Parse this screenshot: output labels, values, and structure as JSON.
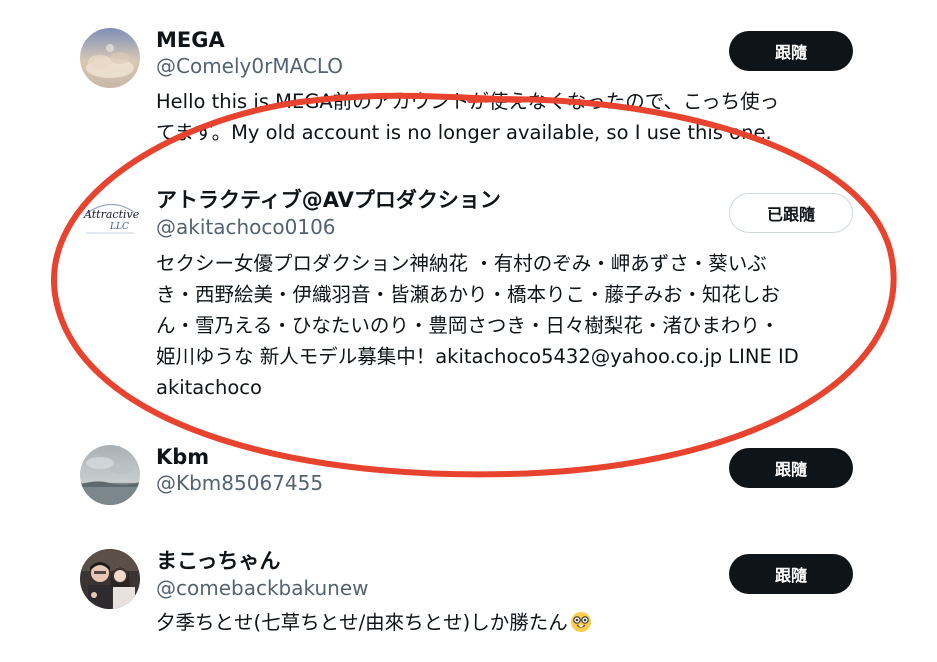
{
  "users": [
    {
      "name": "MEGA",
      "handle": "@Comely0rMACLO",
      "bio_lines": [
        "Hello this is MEGA前のアカウントが使えなくなったので、こっち使っ",
        "てます。My old account is no longer available, so I use this one."
      ],
      "button": "跟隨",
      "button_state": "follow",
      "avatar_icon": "cloud-sky-avatar"
    },
    {
      "name": "アトラクティブ@AVプロダクション",
      "handle": "@akitachoco0106",
      "bio_lines": [
        "セクシー女優プロダクション神納花 ・有村のぞみ・岬あずさ・葵いぶ",
        "き・西野絵美・伊織羽音・皆瀬あかり・橋本りこ・藤子みお・知花しお",
        "ん・雪乃える・ひなたいのり・豊岡さつき・日々樹梨花・渚ひまわり・",
        "姫川ゆうな 新人モデル募集中！akitachoco5432@yahoo.co.jp LINE ID",
        "akitachoco"
      ],
      "button": "已跟隨",
      "button_state": "following",
      "avatar_icon": "attractive-llc-logo",
      "logo_text": "Attractive LLC"
    },
    {
      "name": "Kbm",
      "handle": "@Kbm85067455",
      "bio_lines": [],
      "button": "跟隨",
      "button_state": "follow",
      "avatar_icon": "seascape-avatar"
    },
    {
      "name": "まこっちゃん",
      "handle": "@comebackbakunew",
      "bio_lines": [
        "夕季ちとせ(七草ちとせ/由來ちとせ)しか勝たん"
      ],
      "bio_emoji": "nerd-face-emoji",
      "button": "跟隨",
      "button_state": "follow",
      "avatar_icon": "photo-avatar"
    }
  ],
  "annotation": {
    "type": "red-ellipse-highlight",
    "color": "#e8432e"
  }
}
